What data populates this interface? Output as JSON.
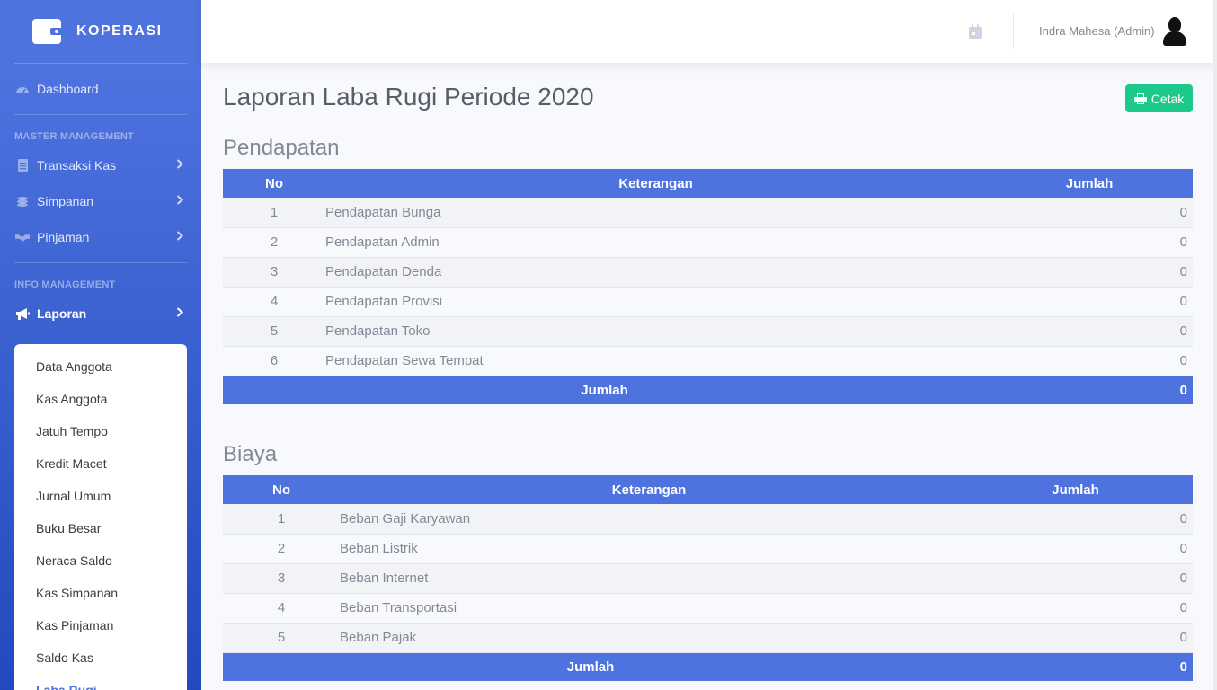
{
  "brand": {
    "name": "KOPERASI"
  },
  "sidebar": {
    "dashboard": "Dashboard",
    "heading_master": "MASTER MANAGEMENT",
    "master_items": [
      {
        "label": "Transaksi Kas"
      },
      {
        "label": "Simpanan"
      },
      {
        "label": "Pinjaman"
      }
    ],
    "heading_info": "INFO MANAGEMENT",
    "laporan": "Laporan",
    "laporan_items": [
      {
        "label": "Data Anggota"
      },
      {
        "label": "Kas Anggota"
      },
      {
        "label": "Jatuh Tempo"
      },
      {
        "label": "Kredit Macet"
      },
      {
        "label": "Jurnal Umum"
      },
      {
        "label": "Buku Besar"
      },
      {
        "label": "Neraca Saldo"
      },
      {
        "label": "Kas Simpanan"
      },
      {
        "label": "Kas Pinjaman"
      },
      {
        "label": "Saldo Kas"
      },
      {
        "label": "Laba Rugi"
      }
    ]
  },
  "topbar": {
    "user": "Indra Mahesa (Admin)"
  },
  "page": {
    "title": "Laporan Laba Rugi Periode 2020",
    "print_label": "Cetak"
  },
  "pendapatan": {
    "title": "Pendapatan",
    "columns": {
      "no": "No",
      "desc": "Keterangan",
      "amount": "Jumlah"
    },
    "rows": [
      {
        "no": "1",
        "desc": "Pendapatan Bunga",
        "amount": "0"
      },
      {
        "no": "2",
        "desc": "Pendapatan Admin",
        "amount": "0"
      },
      {
        "no": "3",
        "desc": "Pendapatan Denda",
        "amount": "0"
      },
      {
        "no": "4",
        "desc": "Pendapatan Provisi",
        "amount": "0"
      },
      {
        "no": "5",
        "desc": "Pendapatan Toko",
        "amount": "0"
      },
      {
        "no": "6",
        "desc": "Pendapatan Sewa Tempat",
        "amount": "0"
      }
    ],
    "total_label": "Jumlah",
    "total_value": "0"
  },
  "biaya": {
    "title": "Biaya",
    "columns": {
      "no": "No",
      "desc": "Keterangan",
      "amount": "Jumlah"
    },
    "rows": [
      {
        "no": "1",
        "desc": "Beban Gaji Karyawan",
        "amount": "0"
      },
      {
        "no": "2",
        "desc": "Beban Listrik",
        "amount": "0"
      },
      {
        "no": "3",
        "desc": "Beban Internet",
        "amount": "0"
      },
      {
        "no": "4",
        "desc": "Beban Transportasi",
        "amount": "0"
      },
      {
        "no": "5",
        "desc": "Beban Pajak",
        "amount": "0"
      }
    ],
    "total_label": "Jumlah",
    "total_value": "0"
  },
  "colors": {
    "primary": "#4e73df",
    "success": "#1cc88a",
    "text": "#5a5c69",
    "muted": "#858796"
  }
}
